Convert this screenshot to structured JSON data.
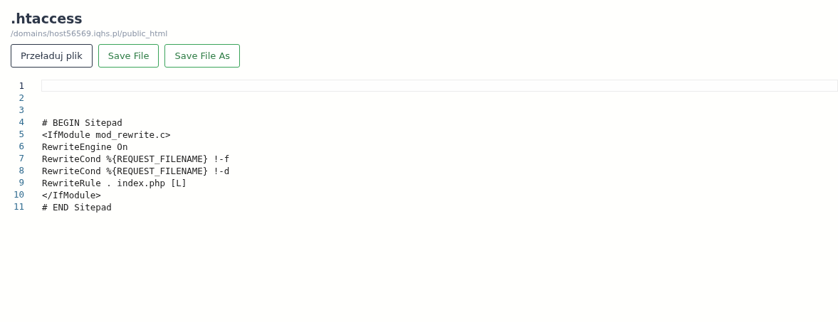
{
  "file": {
    "title": ".htaccess",
    "path": "/domains/host56569.iqhs.pl/public_html"
  },
  "buttons": [
    {
      "label": "Przeładuj plik",
      "kind": "dark"
    },
    {
      "label": "Save File",
      "kind": "green"
    },
    {
      "label": "Save File As",
      "kind": "green"
    }
  ],
  "editor": {
    "lines": [
      {
        "number": "1",
        "active": true
      },
      {
        "number": "2",
        "active": false
      },
      {
        "number": "3",
        "active": false
      },
      {
        "number": "4",
        "text": "# BEGIN Sitepad",
        "active": false
      },
      {
        "number": "5",
        "text": "<IfModule mod_rewrite.c>",
        "active": false
      },
      {
        "number": "6",
        "text": "RewriteEngine On",
        "active": false
      },
      {
        "number": "7",
        "text": "RewriteCond %{REQUEST_FILENAME} !-f",
        "active": false
      },
      {
        "number": "8",
        "text": "RewriteCond %{REQUEST_FILENAME} !-d",
        "active": false
      },
      {
        "number": "9",
        "text": "RewriteRule . index.php [L]",
        "active": false
      },
      {
        "number": "10",
        "text": "</IfModule>",
        "active": false
      },
      {
        "number": "11",
        "text": "# END Sitepad",
        "active": false
      }
    ]
  }
}
